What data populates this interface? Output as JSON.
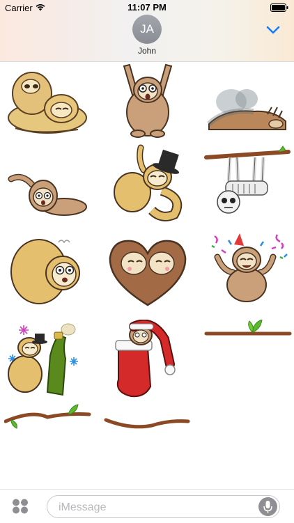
{
  "status_bar": {
    "carrier": "Carrier",
    "time": "11:07 PM"
  },
  "contact": {
    "initials": "JA",
    "name": "John"
  },
  "input": {
    "placeholder": "iMessage",
    "value": ""
  },
  "stickers": [
    {
      "name": "sloth-lying-hug-sticker"
    },
    {
      "name": "sloth-arms-up-sticker"
    },
    {
      "name": "sloth-tired-fog-sticker"
    },
    {
      "name": "sloth-crawling-sticker"
    },
    {
      "name": "sloth-top-hat-sticker"
    },
    {
      "name": "skeleton-sloth-branch-sticker"
    },
    {
      "name": "sloth-grumpy-face-sticker"
    },
    {
      "name": "sloth-heart-hug-sticker"
    },
    {
      "name": "sloth-party-confetti-sticker"
    },
    {
      "name": "branch-leaf-sticker"
    },
    {
      "name": "sloth-champagne-sticker"
    },
    {
      "name": "sloth-christmas-stocking-sticker"
    },
    {
      "name": "branch-leaves-sticker"
    },
    {
      "name": "branch-sticker"
    }
  ],
  "colors": {
    "accent": "#147efb",
    "sloth_fur": "#c9a07a",
    "sloth_fur_yellow": "#e8c77d",
    "branch": "#a0522d",
    "leaf": "#5cb82e"
  }
}
